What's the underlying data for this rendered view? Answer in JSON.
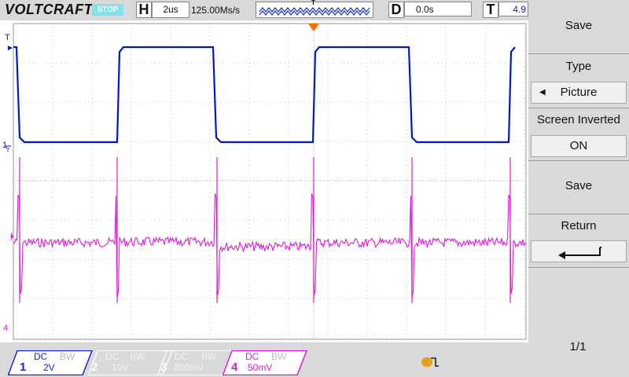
{
  "topbar": {
    "brand": "VOLTCRAFT",
    "brand_mark": ".",
    "run_status": "STOP",
    "timebase_label": "H",
    "timebase_value": "2us",
    "sample_rate": "125.00Ms/s",
    "trigger_marker": "T",
    "delay_label": "D",
    "delay_value": "0.0s",
    "trigger_label": "T",
    "trigger_value": "4.9"
  },
  "screen": {
    "ch1_trigger_marker": "T",
    "ch1_marker": "1",
    "ch4_marker": "4",
    "ch1_color": "#0018c8",
    "ch4_color": "#e21ad9",
    "trigger_color": "#ff6a00"
  },
  "channels": [
    {
      "num": "1",
      "coupling": "DC",
      "bw": "BW",
      "scale": "2V",
      "active": true
    },
    {
      "num": "2",
      "coupling": "DC",
      "bw": "BW",
      "scale": "10V",
      "active": false
    },
    {
      "num": "3",
      "coupling": "DC",
      "bw": "BW",
      "scale": "200mV",
      "active": false
    },
    {
      "num": "4",
      "coupling": "DC",
      "bw": "BW",
      "scale": "50mV",
      "active": true
    }
  ],
  "menu": {
    "title": "Save",
    "type_label": "Type",
    "type_value": "Picture",
    "invert_label": "Screen Inverted",
    "invert_value": "ON",
    "save_label": "Save",
    "return_label": "Return",
    "return_icon": "return-arrow-icon",
    "page": "1/1"
  }
}
